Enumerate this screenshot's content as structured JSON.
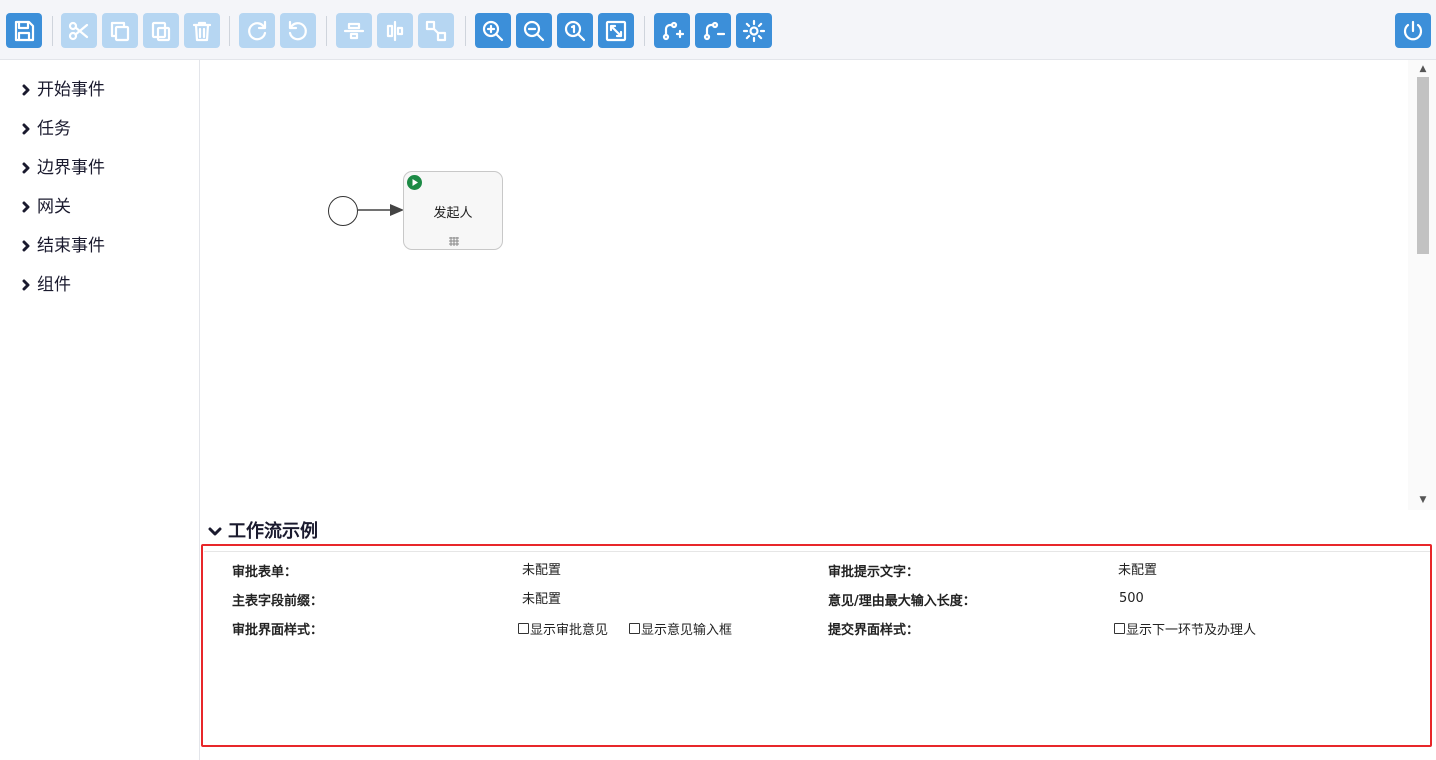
{
  "toolbar": {
    "buttons": [
      {
        "name": "save-button",
        "icon": "save-icon",
        "enabled": true
      },
      {
        "name": "cut-button",
        "icon": "scissors-icon",
        "enabled": false
      },
      {
        "name": "copy-button",
        "icon": "copy-icon",
        "enabled": false
      },
      {
        "name": "paste-button",
        "icon": "paste-icon",
        "enabled": false
      },
      {
        "name": "delete-button",
        "icon": "trash-icon",
        "enabled": false
      },
      {
        "name": "redo-button",
        "icon": "redo-icon",
        "enabled": false
      },
      {
        "name": "undo-button",
        "icon": "undo-icon",
        "enabled": false
      },
      {
        "name": "align-vertical-button",
        "icon": "align-vertical-icon",
        "enabled": false
      },
      {
        "name": "align-horizontal-button",
        "icon": "align-horizontal-icon",
        "enabled": false
      },
      {
        "name": "same-size-button",
        "icon": "same-size-icon",
        "enabled": false
      },
      {
        "name": "zoom-in-button",
        "icon": "zoom-in-icon",
        "enabled": true
      },
      {
        "name": "zoom-out-button",
        "icon": "zoom-out-icon",
        "enabled": true
      },
      {
        "name": "zoom-actual-button",
        "icon": "zoom-actual-icon",
        "enabled": true
      },
      {
        "name": "zoom-fit-button",
        "icon": "zoom-fit-icon",
        "enabled": true
      },
      {
        "name": "add-bendpoint-button",
        "icon": "add-bendpoint-icon",
        "enabled": true
      },
      {
        "name": "remove-bendpoint-button",
        "icon": "remove-bendpoint-icon",
        "enabled": true
      },
      {
        "name": "settings-button",
        "icon": "gear-icon",
        "enabled": true
      },
      {
        "name": "power-button",
        "icon": "power-icon",
        "enabled": true
      }
    ],
    "colors": {
      "active": "#3c8fd9",
      "disabled": "#b6d6f2"
    }
  },
  "sidebar": {
    "items": [
      {
        "label": "开始事件"
      },
      {
        "label": "任务"
      },
      {
        "label": "边界事件"
      },
      {
        "label": "网关"
      },
      {
        "label": "结束事件"
      },
      {
        "label": "组件"
      }
    ]
  },
  "canvas": {
    "task_label": "发起人"
  },
  "panel": {
    "title": "工作流示例",
    "fields": {
      "approval_form_label": "审批表单：",
      "approval_form_value": "未配置",
      "approval_hint_label": "审批提示文字：",
      "approval_hint_value": "未配置",
      "main_prefix_label": "主表字段前缀：",
      "main_prefix_value": "未配置",
      "max_length_label": "意见/理由最大输入长度：",
      "max_length_value": "500",
      "approval_style_label": "审批界面样式：",
      "show_opinion": "显示审批意见",
      "show_input": "显示意见输入框",
      "submit_style_label": "提交界面样式：",
      "show_next": "显示下一环节及办理人"
    },
    "highlight_color": "#e8272a"
  }
}
